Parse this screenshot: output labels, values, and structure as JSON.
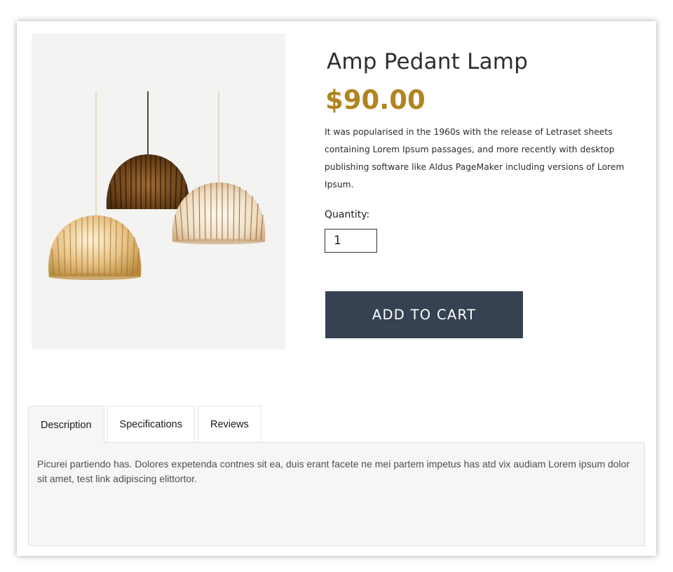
{
  "product": {
    "title": "Amp Pedant Lamp",
    "price": "$90.00",
    "description": "It was popularised in the 1960s with the release of Letraset sheets containing Lorem Ipsum passages, and more recently with desktop publishing software like Aldus PageMaker including versions of Lorem Ipsum.",
    "image_icon": "pendant-lamps-image"
  },
  "quantity": {
    "label": "Quantity:",
    "value": "1"
  },
  "cart": {
    "add_label": "ADD TO CART"
  },
  "tabs": [
    {
      "label": "Description",
      "active": true
    },
    {
      "label": "Specifications",
      "active": false
    },
    {
      "label": "Reviews",
      "active": false
    }
  ],
  "description_panel": {
    "text_before_link": "Picurei partiendo has. Dolores expetenda contnes sit ea, duis erant facete ne mei partem impetus has atd vix audiam Lorem ipsum dolor sit amet, ",
    "link_text": "test link",
    "text_after_link": " adipiscing elittortor."
  },
  "colors": {
    "price": "#b08420",
    "button_bg": "#364251",
    "button_text": "#ffffff",
    "panel_bg": "#f6f6f6"
  }
}
